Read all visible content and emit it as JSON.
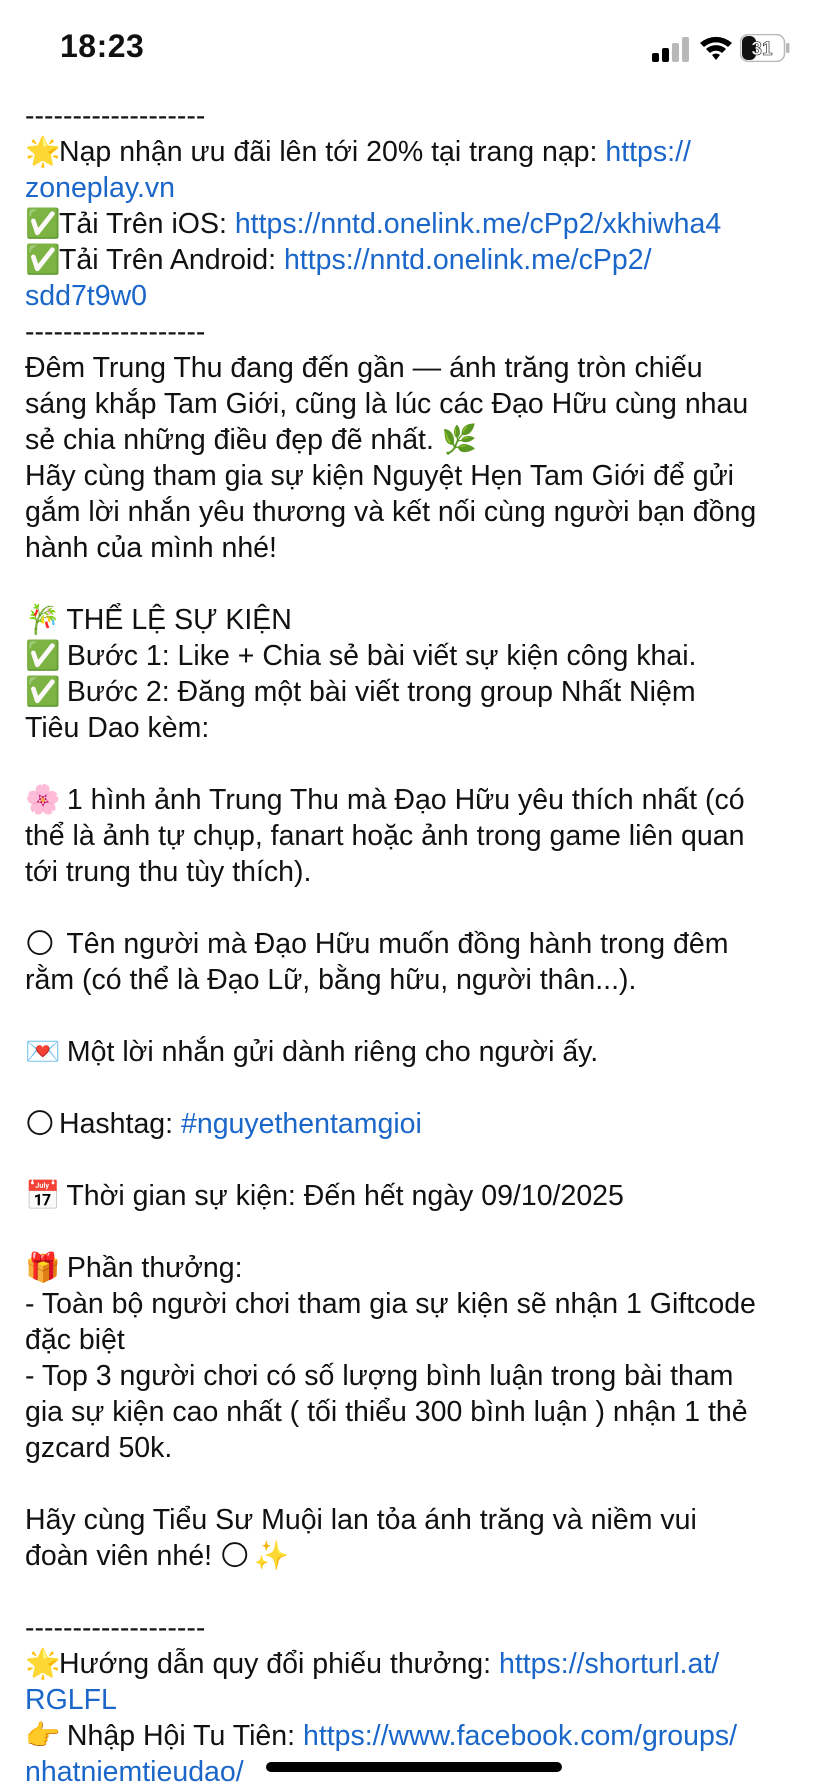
{
  "status_bar": {
    "time": "18:23",
    "battery": "31"
  },
  "lines": [
    {
      "parts": [
        {
          "t": "-------------------"
        }
      ]
    },
    {
      "parts": [
        {
          "e": "🌟"
        },
        {
          "t": "Nạp nhận ưu đãi lên tới 20% tại trang nạp: "
        },
        {
          "t": "https://",
          "link": true
        }
      ]
    },
    {
      "parts": [
        {
          "t": "zoneplay.vn",
          "link": true
        }
      ]
    },
    {
      "parts": [
        {
          "e": "✅"
        },
        {
          "t": "Tải Trên iOS: "
        },
        {
          "t": "https://nntd.onelink.me/cPp2/xkhiwha4",
          "link": true
        }
      ]
    },
    {
      "parts": [
        {
          "e": "✅"
        },
        {
          "t": "Tải Trên Android: "
        },
        {
          "t": "https://nntd.onelink.me/cPp2/",
          "link": true
        }
      ]
    },
    {
      "parts": [
        {
          "t": "sdd7t9w0",
          "link": true
        }
      ]
    },
    {
      "parts": [
        {
          "t": "-------------------"
        }
      ]
    },
    {
      "parts": [
        {
          "t": "Đêm Trung Thu đang đến gần — ánh trăng tròn chiếu"
        }
      ]
    },
    {
      "parts": [
        {
          "t": "sáng khắp Tam Giới, cũng là lúc các Đạo Hữu cùng nhau"
        }
      ]
    },
    {
      "parts": [
        {
          "t": "sẻ chia những điều đẹp đẽ nhất. "
        },
        {
          "e": "🌿"
        }
      ]
    },
    {
      "parts": [
        {
          "t": "Hãy cùng tham gia sự kiện Nguyệt Hẹn Tam Giới để gửi"
        }
      ]
    },
    {
      "parts": [
        {
          "t": "gắm lời nhắn yêu thương và kết nối cùng người bạn đồng"
        }
      ]
    },
    {
      "parts": [
        {
          "t": "hành của mình nhé!"
        }
      ]
    },
    {
      "parts": []
    },
    {
      "parts": [
        {
          "e": "🎋"
        },
        {
          "t": " THỂ LỆ SỰ KIỆN"
        }
      ]
    },
    {
      "parts": [
        {
          "e": "✅"
        },
        {
          "t": " Bước 1: Like + Chia sẻ bài viết sự kiện công khai."
        }
      ]
    },
    {
      "parts": [
        {
          "e": "✅"
        },
        {
          "t": " Bước 2: Đăng một bài viết trong group Nhất Niệm"
        }
      ]
    },
    {
      "parts": [
        {
          "t": "Tiêu Dao kèm:"
        }
      ]
    },
    {
      "parts": []
    },
    {
      "parts": [
        {
          "e": "🌸"
        },
        {
          "t": " 1 hình ảnh Trung Thu mà Đạo Hữu yêu thích nhất (có"
        }
      ]
    },
    {
      "parts": [
        {
          "t": "thể là ảnh tự chụp, fanart hoặc ảnh trong game liên quan"
        }
      ]
    },
    {
      "parts": [
        {
          "t": "tới trung thu tùy thích)."
        }
      ]
    },
    {
      "parts": []
    },
    {
      "parts": [
        {
          "e": "🌕"
        },
        {
          "t": " Tên người mà Đạo Hữu muốn đồng hành trong đêm"
        }
      ]
    },
    {
      "parts": [
        {
          "t": "rằm (có thể là Đạo Lữ, bằng hữu, người thân...)."
        }
      ]
    },
    {
      "parts": []
    },
    {
      "parts": [
        {
          "e": "💌"
        },
        {
          "t": " Một lời nhắn gửi dành riêng cho người ấy."
        }
      ]
    },
    {
      "parts": []
    },
    {
      "parts": [
        {
          "e": "🌕"
        },
        {
          "t": "Hashtag: "
        },
        {
          "t": "#nguyethentamgioi",
          "link": true
        }
      ]
    },
    {
      "parts": []
    },
    {
      "parts": [
        {
          "e": "📅"
        },
        {
          "t": " Thời gian sự kiện: Đến hết ngày 09/10/2025"
        }
      ]
    },
    {
      "parts": []
    },
    {
      "parts": [
        {
          "e": "🎁"
        },
        {
          "t": " Phần thưởng:"
        }
      ]
    },
    {
      "parts": [
        {
          "t": "- Toàn bộ người chơi tham gia sự kiện sẽ nhận 1 Giftcode"
        }
      ]
    },
    {
      "parts": [
        {
          "t": "đặc biệt"
        }
      ]
    },
    {
      "parts": [
        {
          "t": "- Top 3 người chơi có số lượng bình luận trong bài tham"
        }
      ]
    },
    {
      "parts": [
        {
          "t": "gia sự kiện cao nhất ( tối thiểu 300 bình luận ) nhận 1 thẻ"
        }
      ]
    },
    {
      "parts": [
        {
          "t": "gzcard 50k."
        }
      ]
    },
    {
      "parts": []
    },
    {
      "parts": [
        {
          "t": "Hãy cùng Tiểu Sư Muội lan tỏa ánh trăng và niềm vui"
        }
      ]
    },
    {
      "parts": [
        {
          "t": "đoàn viên nhé! "
        },
        {
          "e": "🌕"
        },
        {
          "e": "✨"
        }
      ]
    },
    {
      "parts": []
    },
    {
      "parts": [
        {
          "t": "-------------------"
        }
      ]
    },
    {
      "parts": [
        {
          "e": "🌟"
        },
        {
          "t": "Hướng dẫn quy đổi phiếu thưởng: "
        },
        {
          "t": "https://shorturl.at/",
          "link": true
        }
      ]
    },
    {
      "parts": [
        {
          "t": "RGLFL",
          "link": true
        }
      ]
    },
    {
      "parts": [
        {
          "e": "👉"
        },
        {
          "t": " Nhập Hội Tu Tiên: "
        },
        {
          "t": "https://www.facebook.com/groups/",
          "link": true
        }
      ]
    },
    {
      "parts": [
        {
          "t": "nhatniemtieudao/",
          "link": true
        }
      ]
    }
  ]
}
